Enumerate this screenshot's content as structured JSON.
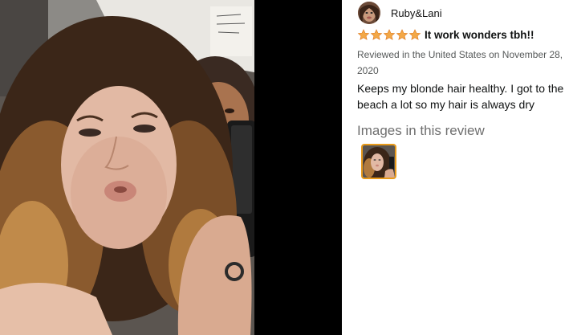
{
  "review": {
    "reviewer_name": "Ruby&Lani",
    "rating": 5,
    "rating_max": 5,
    "title": "It work wonders tbh!!",
    "meta": "Reviewed in the United States on November 28, 2020",
    "body": "Keeps my blonde hair healthy. I got to the beach a lot so my hair is always dry",
    "images_heading": "Images in this review"
  },
  "colors": {
    "star": "#f3a847",
    "thumb_border": "#e89a1a",
    "panel_bg": "#ffffff",
    "backdrop": "#000000"
  }
}
